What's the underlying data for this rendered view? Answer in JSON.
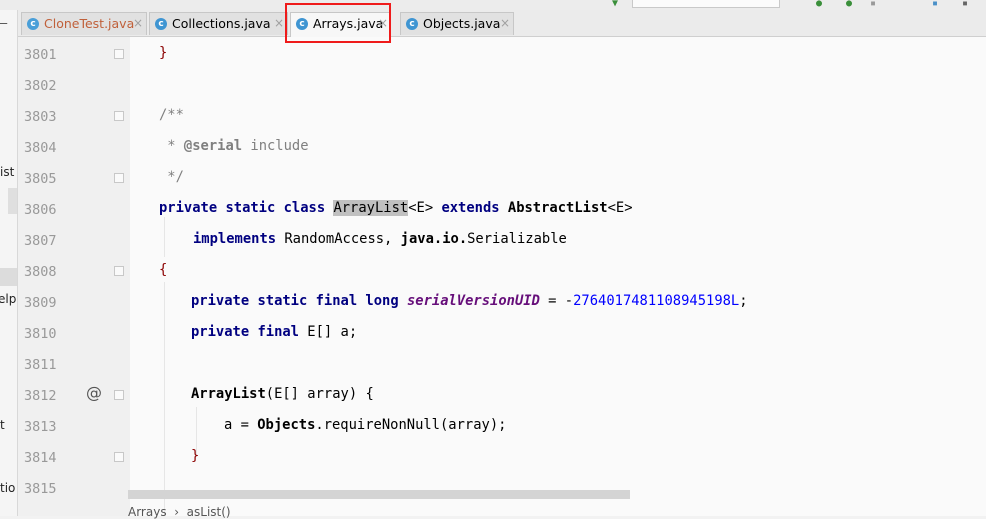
{
  "tabs": [
    {
      "label": "CloneTest.java",
      "color": "#c0603a"
    },
    {
      "label": "Collections.java",
      "color": "#222222"
    },
    {
      "label": "Arrays.java",
      "color": "#222222",
      "active": true
    },
    {
      "label": "Objects.java",
      "color": "#222222"
    }
  ],
  "tab_close_glyph": "×",
  "left_fragments": [
    "ist",
    "elp",
    "t",
    "tio"
  ],
  "gutter": {
    "line_numbers": [
      "3801",
      "3802",
      "3803",
      "3804",
      "3805",
      "3806",
      "3807",
      "3808",
      "3809",
      "3810",
      "3811",
      "3812",
      "3813",
      "3814",
      "3815"
    ],
    "annotation_glyph": "@"
  },
  "code": {
    "l3801": "}",
    "l3803": "/**",
    "l3804_star": " * ",
    "l3804_tag": "@serial",
    "l3804_rest": " include",
    "l3805": " */",
    "l3806_kw": "private static class ",
    "l3806_name": "ArrayList",
    "l3806_gen": "<E> ",
    "l3806_ext": "extends ",
    "l3806_sup": "AbstractList",
    "l3806_gen2": "<E>",
    "l3807_kw": "implements ",
    "l3807_ra": "RandomAccess, ",
    "l3807_pkg": "java.io.",
    "l3807_ser": "Serializable",
    "l3808": "{",
    "l3809_kw": "private static final long ",
    "l3809_fld": "serialVersionUID",
    "l3809_eq": " = -",
    "l3809_num": "2764017481108945198L",
    "l3809_end": ";",
    "l3810_kw": "private final ",
    "l3810_rest": "E[] a;",
    "l3812_ctor": "ArrayList",
    "l3812_rest": "(E[] array) {",
    "l3813_a": "a = ",
    "l3813_cls": "Objects",
    "l3813_rest": ".requireNonNull(array);",
    "l3814": "}"
  },
  "breadcrumb": {
    "part1": "Arrays",
    "sep": "›",
    "part2": "asList()"
  },
  "colors": {
    "highlight_border": "#ef1b1b",
    "keyword": "#000080",
    "number": "#0000ff",
    "field": "#660e7a"
  }
}
